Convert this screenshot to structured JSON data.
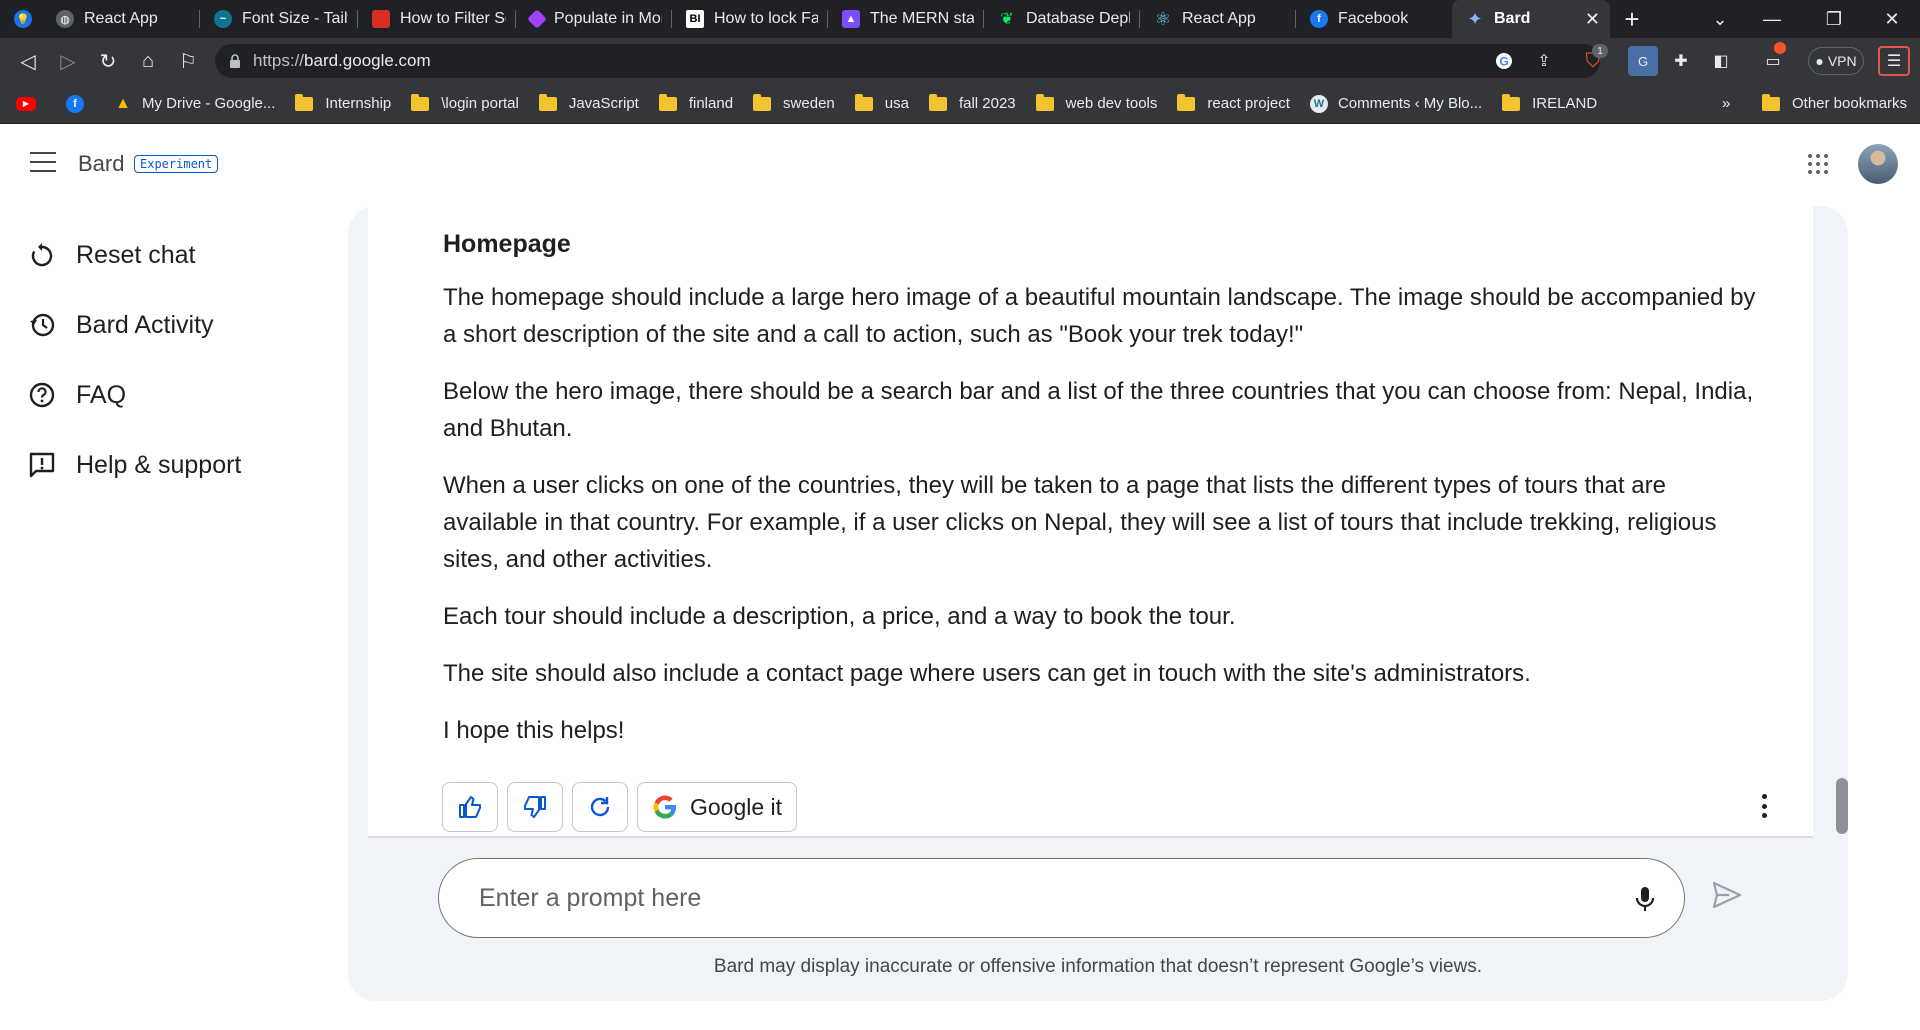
{
  "browser": {
    "tabs": [
      {
        "title": "",
        "icon": "bulb-icon",
        "color": "#1a73e8"
      },
      {
        "title": "React App",
        "icon": "globe-icon",
        "color": "#5f6368"
      },
      {
        "title": "Font Size - Tailw",
        "icon": "tailwind-icon",
        "color": "#38bdf8"
      },
      {
        "title": "How to Filter Se",
        "icon": "red-icon",
        "color": "#d93025"
      },
      {
        "title": "Populate in Mon",
        "icon": "diamond-icon",
        "color": "#a142f4"
      },
      {
        "title": "How to lock Fac",
        "icon": "bi-icon",
        "color": "#ffffff"
      },
      {
        "title": "The MERN stack",
        "icon": "mern-icon",
        "color": "#7c4dff"
      },
      {
        "title": "Database Deplo",
        "icon": "leaf-icon",
        "color": "#00ed64"
      },
      {
        "title": "React App",
        "icon": "react-icon",
        "color": "#61dafb"
      },
      {
        "title": "Facebook",
        "icon": "facebook-icon",
        "color": "#1877f2"
      },
      {
        "title": "Bard",
        "icon": "bard-icon",
        "color": "#8ab4f8",
        "active": true
      }
    ],
    "address": {
      "scheme": "https://",
      "host": "bard.google.com"
    },
    "brave_badge": "1",
    "vpn_label": "VPN",
    "bookmarks": [
      {
        "label": "",
        "type": "youtube"
      },
      {
        "label": "",
        "type": "facebook"
      },
      {
        "label": "My Drive - Google...",
        "type": "drive"
      },
      {
        "label": "Internship",
        "type": "folder"
      },
      {
        "label": "\\login portal",
        "type": "folder"
      },
      {
        "label": "JavaScript",
        "type": "folder"
      },
      {
        "label": "finland",
        "type": "folder"
      },
      {
        "label": "sweden",
        "type": "folder"
      },
      {
        "label": "usa",
        "type": "folder"
      },
      {
        "label": "fall 2023",
        "type": "folder"
      },
      {
        "label": "web dev tools",
        "type": "folder"
      },
      {
        "label": "react project",
        "type": "folder"
      },
      {
        "label": "Comments ‹ My Blo...",
        "type": "wordpress"
      },
      {
        "label": "IRELAND",
        "type": "folder"
      }
    ],
    "bookmarks_overflow": "»",
    "other_bookmarks": "Other bookmarks"
  },
  "header": {
    "brand": "Bard",
    "badge": "Experiment"
  },
  "sidebar": {
    "items": [
      {
        "label": "Reset chat",
        "icon": "reset-icon"
      },
      {
        "label": "Bard Activity",
        "icon": "history-icon"
      },
      {
        "label": "FAQ",
        "icon": "help-icon"
      },
      {
        "label": "Help & support",
        "icon": "feedback-icon"
      }
    ]
  },
  "response": {
    "heading": "Homepage",
    "paragraphs": [
      "The homepage should include a large hero image of a beautiful mountain landscape. The image should be accompanied by a short description of the site and a call to action, such as \"Book your trek today!\"",
      "Below the hero image, there should be a search bar and a list of the three countries that you can choose from: Nepal, India, and Bhutan.",
      "When a user clicks on one of the countries, they will be taken to a page that lists the different types of tours that are available in that country. For example, if a user clicks on Nepal, they will see a list of tours that include trekking, religious sites, and other activities.",
      "Each tour should include a description, a price, and a way to book the tour.",
      "The site should also include a contact page where users can get in touch with the site's administrators.",
      "I hope this helps!"
    ],
    "google_it_label": "Google it"
  },
  "prompt": {
    "placeholder": "Enter a prompt here",
    "value": ""
  },
  "disclaimer": "Bard may display inaccurate or offensive information that doesn’t represent Google’s views."
}
